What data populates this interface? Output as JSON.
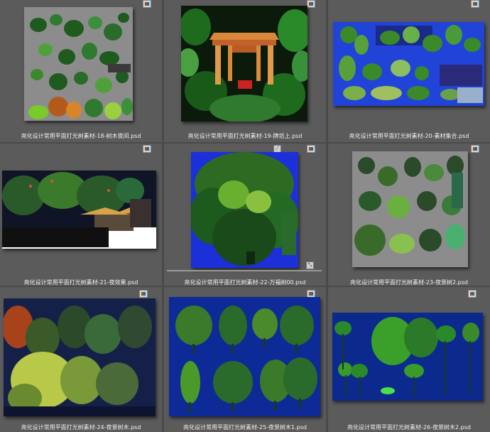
{
  "files": [
    {
      "label": "亮化设计常用平面打光树素材-18-树木夜间.psd"
    },
    {
      "label": "亮化设计常用平面打光树素材-19-牌坊上.psd"
    },
    {
      "label": "亮化设计常用平面打光树素材-20-素材集合.psd"
    },
    {
      "label": "亮化设计常用平面打光树素材-21-夜效果.psd"
    },
    {
      "label": "亮化设计常用平面打光树素材-22-万福树00.psd"
    },
    {
      "label": "亮化设计常用平面打光树素材-23-夜景树2.psd"
    },
    {
      "label": "亮化设计常用平面打光树素材-24-夜景树木.psd"
    },
    {
      "label": "亮化设计常用平面打光树素材-25-夜景树木1.psd"
    },
    {
      "label": "亮化设计常用平面打光树素材-26-夜景树木2.psd"
    }
  ],
  "icons": {
    "file_type": "photoshop-file-icon",
    "rotate": "rotate-icon",
    "resize": "resize-icon"
  },
  "colors": {
    "background": "#5e5e5e",
    "caption": "#f2f2f2",
    "night_blue": "#1b3f8f",
    "gray_canvas": "#8a8a8a"
  }
}
